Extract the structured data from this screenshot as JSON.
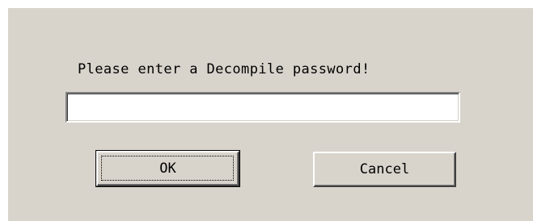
{
  "dialog": {
    "prompt_text": "Please enter a Decompile password!",
    "password_value": "",
    "ok_label": "OK",
    "cancel_label": "Cancel"
  }
}
